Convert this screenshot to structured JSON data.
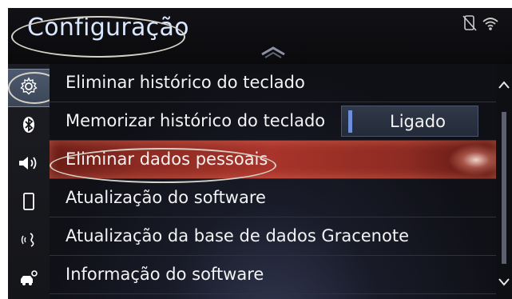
{
  "header": {
    "title": "Configuração",
    "status_icons": [
      "phone-disconnected-icon",
      "wifi-icon"
    ]
  },
  "sidebar": {
    "items": [
      {
        "icon": "gear-icon",
        "active": true
      },
      {
        "icon": "bluetooth-icon",
        "active": false
      },
      {
        "icon": "speaker-icon",
        "active": false
      },
      {
        "icon": "phone-icon",
        "active": false
      },
      {
        "icon": "voice-icon",
        "active": false
      },
      {
        "icon": "car-settings-icon",
        "active": false
      }
    ]
  },
  "list": {
    "items": [
      {
        "label": "Eliminar histórico do teclado"
      },
      {
        "label": "Memorizar histórico do teclado",
        "value": "Ligado"
      },
      {
        "label": "Eliminar dados pessoais",
        "highlighted": true
      },
      {
        "label": "Atualização do software"
      },
      {
        "label": "Atualização da base de dados Gracenote"
      },
      {
        "label": "Informação do software"
      }
    ]
  },
  "colors": {
    "accent": "#6d8fdc",
    "highlight": "#a8342b",
    "annotation_ring": "#d6d1c6"
  }
}
